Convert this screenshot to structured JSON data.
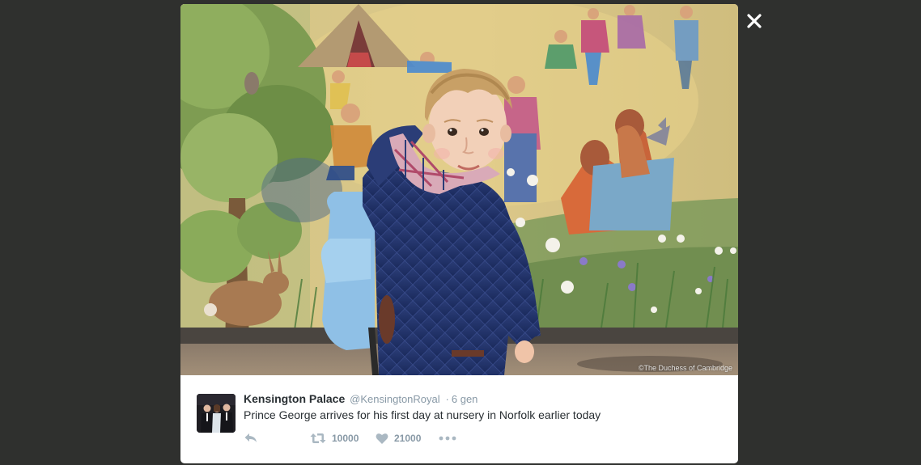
{
  "photo": {
    "alt": "Prince George at nursery",
    "credit": "©The Duchess of Cambridge"
  },
  "tweet": {
    "display_name": "Kensington Palace",
    "screen_name": "@KensingtonRoyal",
    "separator": "·",
    "timestamp": "6 gen",
    "text": "Prince George arrives for his first day at nursery in Norfolk earlier today",
    "retweet_count": "10000",
    "like_count": "21000"
  },
  "icons": {
    "close": "close-icon",
    "reply": "reply-icon",
    "retweet": "retweet-icon",
    "like": "heart-icon",
    "more": "more-dots-icon"
  },
  "colors": {
    "overlay": "#2f302e",
    "text": "#292f33",
    "muted": "#8899a6",
    "icon": "#aab8c2"
  }
}
